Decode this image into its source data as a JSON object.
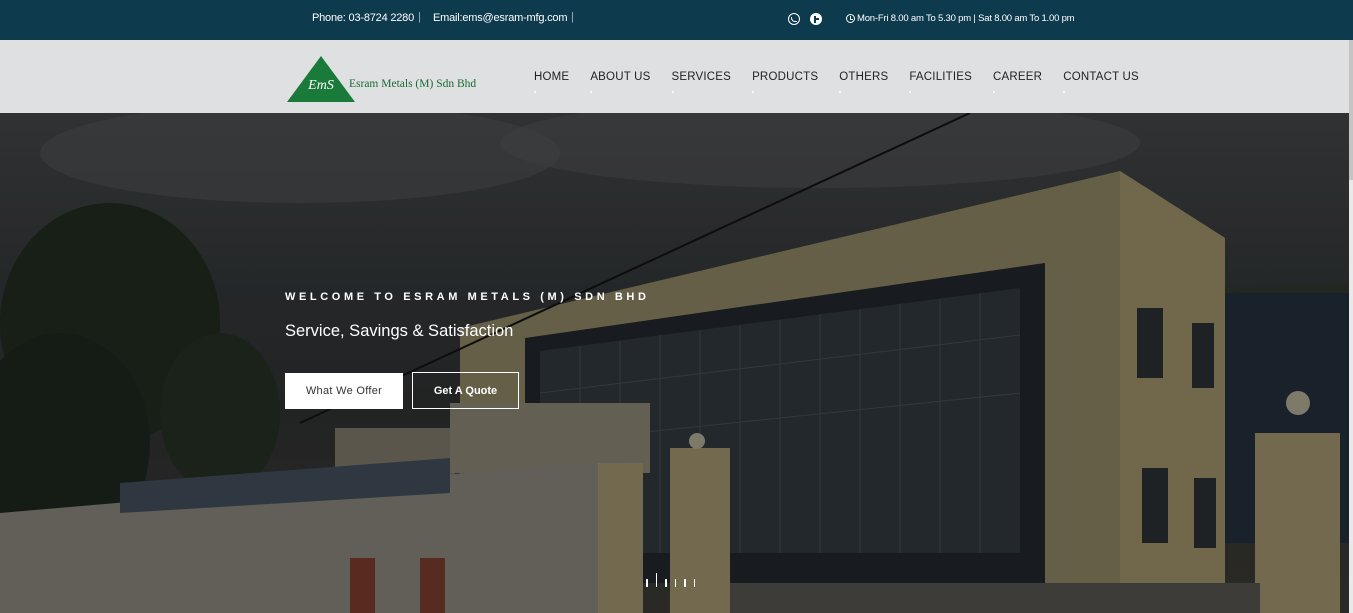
{
  "topbar": {
    "phone": "Phone: 03-8724 2280",
    "separator": "|",
    "email": "Email:ems@esram-mfg.com",
    "hours": "Mon-Fri 8.00 am To 5.30 pm | Sat 8.00 am To 1.00 pm",
    "social_icons": [
      "whatsapp-icon",
      "facebook-icon"
    ],
    "background": "#0d3a4d"
  },
  "header": {
    "logo_text": "EmS",
    "brand_name": "Esram Metals (M) Sdn Bhd",
    "brand_color": "#1a6b32",
    "nav": [
      "HOME",
      "ABOUT US",
      "SERVICES",
      "PRODUCTS",
      "OTHERS",
      "FACILITIES",
      "CAREER",
      "CONTACT US"
    ]
  },
  "hero": {
    "eyebrow": "WELCOME TO ESRAM METALS (M) SDN BHD",
    "headline": "Service, Savings & Satisfaction",
    "primary_button": "What We Offer",
    "secondary_button": "Get A Quote",
    "slide_indicators": 6,
    "active_slide": 2
  }
}
